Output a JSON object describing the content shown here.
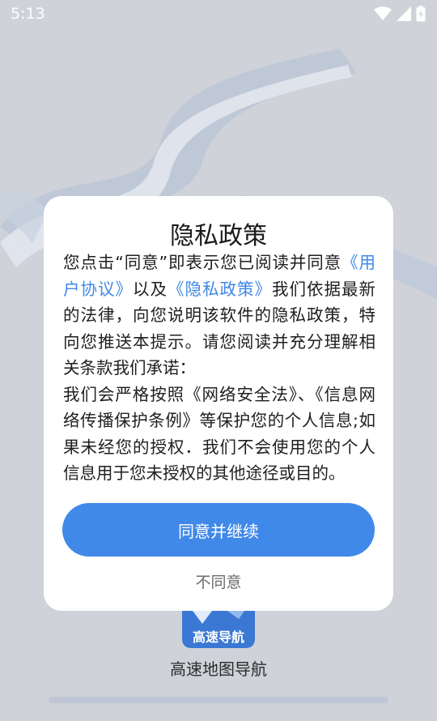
{
  "status_bar": {
    "time": "5:13",
    "icons": [
      "wifi-icon",
      "cellular-signal-icon",
      "battery-charging-icon"
    ]
  },
  "dialog": {
    "title": "隐私政策",
    "body_intro": "您点击“同意”即表示您已阅读并同意",
    "user_agreement_link": "《用户协议》",
    "and_text": "以及",
    "privacy_policy_link": "《隐私政策》",
    "body_rest": "我们依据最新的法律，向您说明该软件的隐私政策，特向您推送本提示。请您阅读并充分理解相关条款我们承诺：",
    "body_commitment": "我们会严格按照《网络安全法》、《信息网络传播保护条例》等保护您的个人信息;如果未经您的授权．我们不会使用您的个人信息用于您未授权的其他途径或目的。",
    "agree_label": "同意并继续",
    "disagree_label": "不同意"
  },
  "app": {
    "logo_text": "高速导航",
    "name": "高速地图导航"
  },
  "colors": {
    "accent": "#4189e9",
    "link": "#3f88e6",
    "overlay_background": "#cfd2d8"
  }
}
